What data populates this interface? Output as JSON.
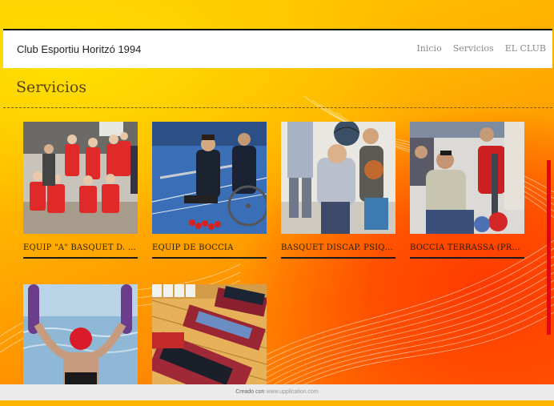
{
  "header": {
    "brand": "Club Esportiu Horitzó 1994",
    "nav": [
      "Inicio",
      "Servicios",
      "EL CLUB"
    ]
  },
  "page": {
    "title": "Servicios"
  },
  "cards": [
    {
      "label": "EQUIP \"A\" BÀSQUET D. PSÍ..."
    },
    {
      "label": "EQUIP DE BOCCIA"
    },
    {
      "label": "BÀSQUET DISCAP. PSÍQUICS..."
    },
    {
      "label": "BOCCIA TERRASSA (PRODIS)"
    },
    {
      "label": ""
    },
    {
      "label": ""
    }
  ],
  "footer": {
    "prefix": "Creado con",
    "link": "www.upplication.com"
  },
  "colors": {
    "header_bg": "#ffffff",
    "accent_red": "#e8001a",
    "title_color": "#5a4200"
  }
}
